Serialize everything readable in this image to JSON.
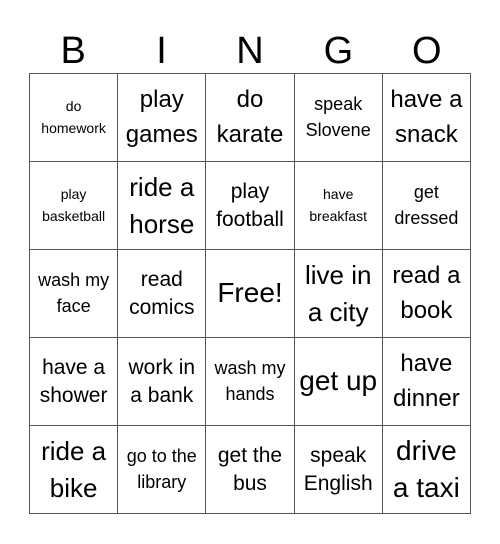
{
  "header": [
    "B",
    "I",
    "N",
    "G",
    "O"
  ],
  "cells": [
    {
      "text": "do homework",
      "size": "s1"
    },
    {
      "text": "play games",
      "size": "s4"
    },
    {
      "text": "do karate",
      "size": "s4"
    },
    {
      "text": "speak Slovene",
      "size": "s2"
    },
    {
      "text": "have a snack",
      "size": "s4"
    },
    {
      "text": "play basketball",
      "size": "s1"
    },
    {
      "text": "ride a horse",
      "size": "s5"
    },
    {
      "text": "play football",
      "size": "s3"
    },
    {
      "text": "have breakfast",
      "size": "s1"
    },
    {
      "text": "get dressed",
      "size": "s2"
    },
    {
      "text": "wash my face",
      "size": "s2"
    },
    {
      "text": "read comics",
      "size": "s3"
    },
    {
      "text": "Free!",
      "size": "s6"
    },
    {
      "text": "live in a city",
      "size": "s5"
    },
    {
      "text": "read a book",
      "size": "s4"
    },
    {
      "text": "have a shower",
      "size": "s3"
    },
    {
      "text": "work in a bank",
      "size": "s3"
    },
    {
      "text": "wash my hands",
      "size": "s2"
    },
    {
      "text": "get up",
      "size": "s6"
    },
    {
      "text": "have dinner",
      "size": "s4"
    },
    {
      "text": "ride a bike",
      "size": "s5"
    },
    {
      "text": "go to the library",
      "size": "s2"
    },
    {
      "text": "get the bus",
      "size": "s3"
    },
    {
      "text": "speak English",
      "size": "s3"
    },
    {
      "text": "drive a taxi",
      "size": "s6"
    }
  ]
}
